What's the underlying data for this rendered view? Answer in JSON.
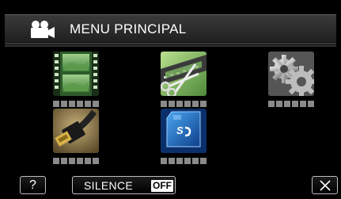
{
  "header": {
    "title": "MENU PRINCIPAL",
    "icon": "video-camera-icon"
  },
  "tiles": [
    {
      "name": "film-tile",
      "icon": "film-strip-icon"
    },
    {
      "name": "edit-tile",
      "icon": "film-scissors-icon"
    },
    {
      "name": "settings-tile",
      "icon": "gears-icon"
    },
    {
      "name": "connect-tile",
      "icon": "hdmi-cable-icon"
    },
    {
      "name": "sd-card-tile",
      "icon": "sd-card-icon"
    }
  ],
  "bottom": {
    "help_label": "?",
    "silence_label": "SILENCE",
    "silence_state": "OFF"
  },
  "colors": {
    "background": "#000000",
    "header": "#2c2c2c",
    "label_bar": "#8a8a8a",
    "sd_blue": "#1d73c8"
  }
}
